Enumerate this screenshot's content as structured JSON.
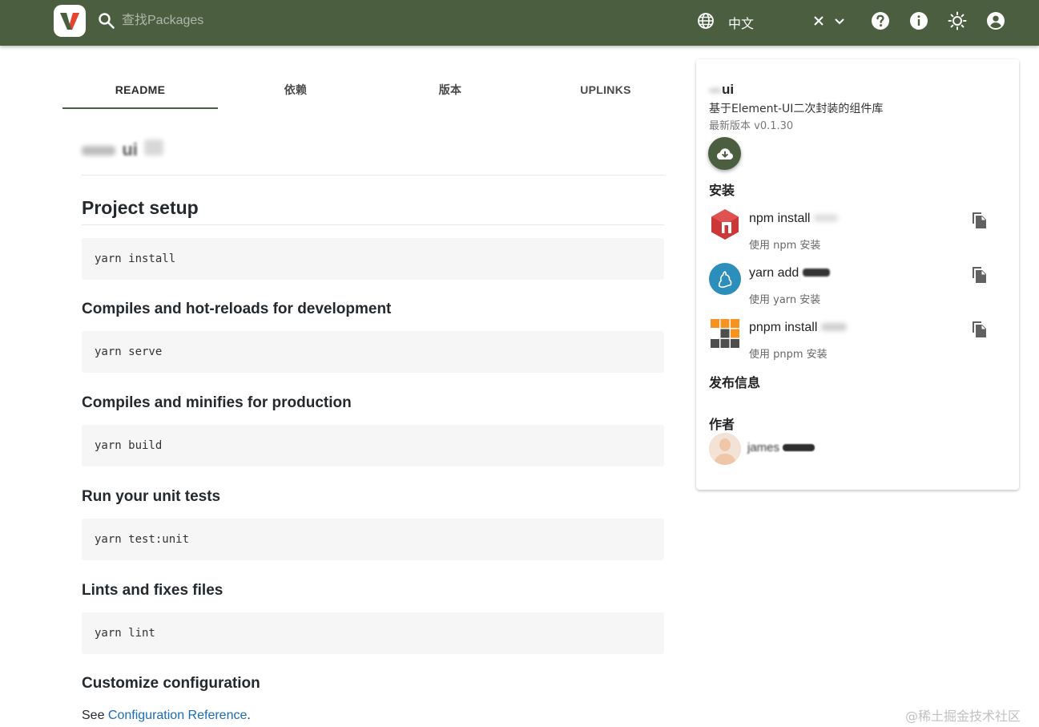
{
  "header": {
    "search_placeholder": "查找Packages",
    "language": "中文",
    "icons": [
      "search-icon",
      "globe-icon",
      "close-icon",
      "chevron-down-icon",
      "help-icon",
      "info-icon",
      "theme-icon",
      "account-icon"
    ]
  },
  "tabs": [
    {
      "label": "README",
      "active": true
    },
    {
      "label": "依赖",
      "active": false
    },
    {
      "label": "版本",
      "active": false
    },
    {
      "label": "UPLINKS",
      "active": false
    }
  ],
  "readme": {
    "package_name_redacted": "ui",
    "heading": "Project setup",
    "sections": [
      {
        "title": "",
        "code": "yarn install"
      },
      {
        "title": "Compiles and hot-reloads for development",
        "code": "yarn serve"
      },
      {
        "title": "Compiles and minifies for production",
        "code": "yarn build"
      },
      {
        "title": "Run your unit tests",
        "code": "yarn test:unit"
      },
      {
        "title": "Lints and fixes files",
        "code": "yarn lint"
      }
    ],
    "customize_title": "Customize configuration",
    "see_prefix": "See ",
    "see_link": "Configuration Reference",
    "see_suffix": "."
  },
  "sidebar": {
    "title": "ui",
    "description": "基于Element-UI二次封装的组件库",
    "latest_version": "最新版本 v0.1.30",
    "install_title": "安装",
    "install": [
      {
        "command": "npm install",
        "subtitle": "使用 npm 安装",
        "icon": "npm-icon"
      },
      {
        "command": "yarn add",
        "subtitle": "使用 yarn 安装",
        "icon": "yarn-icon"
      },
      {
        "command": "pnpm install",
        "subtitle": "使用 pnpm 安装",
        "icon": "pnpm-icon"
      }
    ],
    "publish_title": "发布信息",
    "author_title": "作者",
    "author_name": "james"
  },
  "watermark": "@稀土掘金技术社区",
  "colors": {
    "primary": "#4b5e40",
    "link": "#1a6cb5",
    "npm": "#cb3837",
    "yarn": "#2c8ebb",
    "pnpm": "#f69220"
  }
}
